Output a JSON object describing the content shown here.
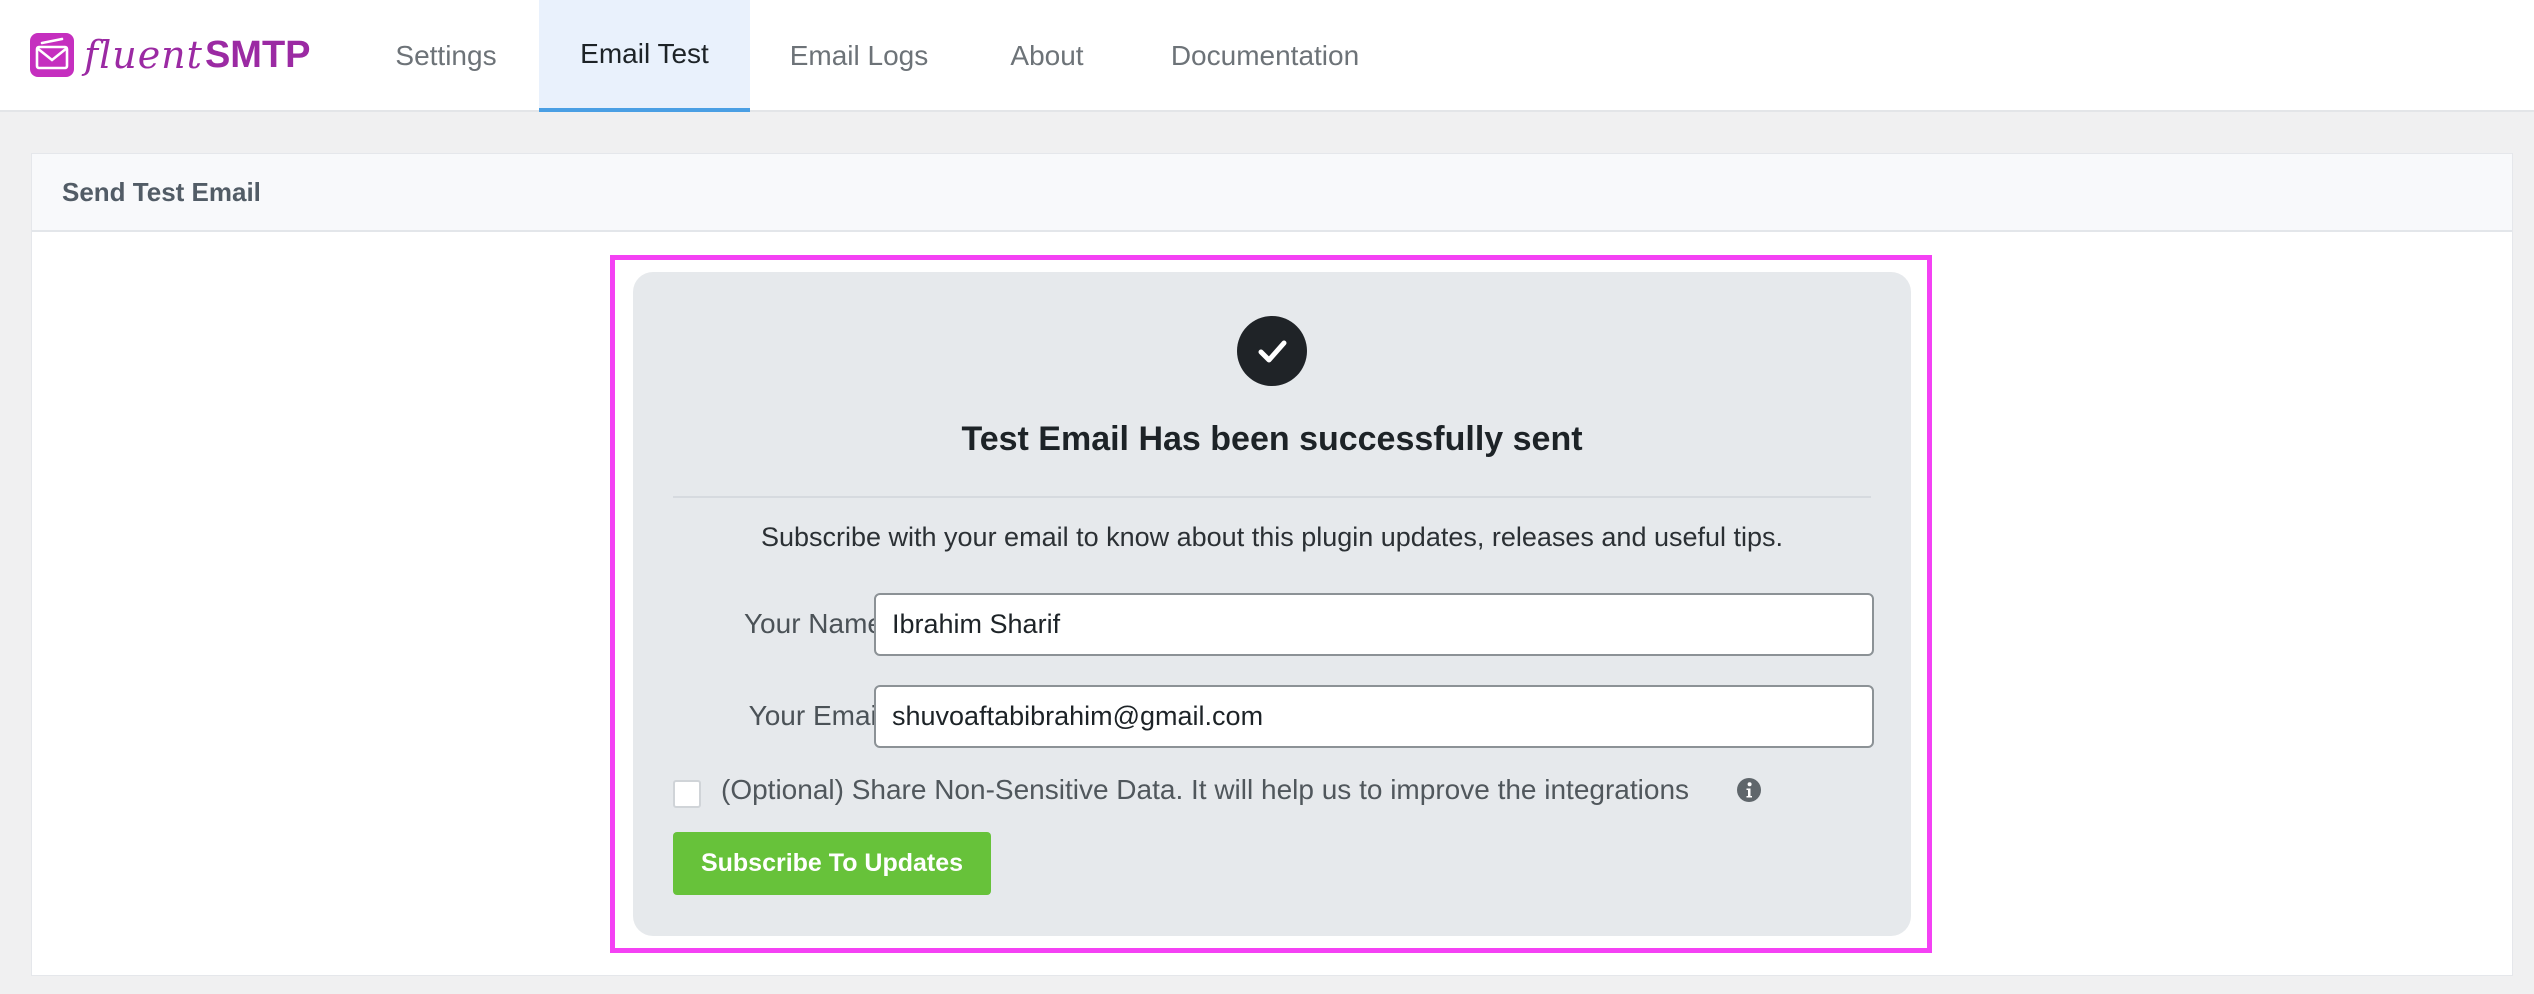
{
  "brand": {
    "name_light": "fluent",
    "name_bold": "SMTP",
    "icon": "envelope-logo-icon"
  },
  "nav": {
    "tabs": [
      {
        "label": "Settings",
        "active": false
      },
      {
        "label": "Email Test",
        "active": true
      },
      {
        "label": "Email Logs",
        "active": false
      },
      {
        "label": "About",
        "active": false
      },
      {
        "label": "Documentation",
        "active": false
      }
    ]
  },
  "panel": {
    "title": "Send Test Email"
  },
  "result": {
    "icon": "check-circle-icon",
    "title": "Test Email Has been successfully sent",
    "subscribe_text": "Subscribe with your email to know about this plugin updates, releases and useful tips."
  },
  "form": {
    "name_label": "Your Name",
    "name_value": "Ibrahim Sharif",
    "email_label": "Your Email",
    "email_value": "shuvoaftabibrahim@gmail.com",
    "share_checked": false,
    "share_label": "(Optional) Share Non-Sensitive Data. It will help us to improve the integrations",
    "info_icon": "info-icon",
    "submit_label": "Subscribe To Updates"
  },
  "colors": {
    "brand": "#9b2aa3",
    "active_tab_bg": "#e9f1fc",
    "active_tab_border": "#4a9fe4",
    "highlight": "#f441f4",
    "button": "#67c23a"
  }
}
